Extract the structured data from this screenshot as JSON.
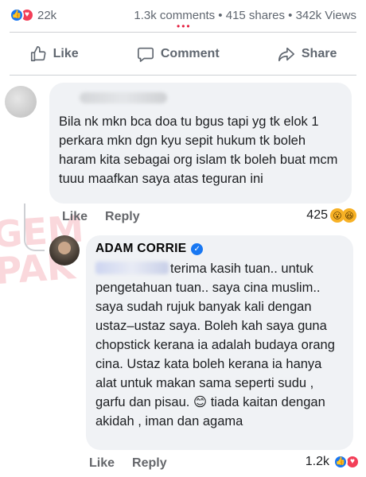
{
  "stats": {
    "reactions_count": "22k",
    "comments": "1.3k comments",
    "shares": "415 shares",
    "views": "342k Views",
    "separator": "•"
  },
  "actions": {
    "like_label": "Like",
    "comment_label": "Comment",
    "share_label": "Share"
  },
  "comment1": {
    "text": "Bila nk mkn bca doa tu bgus tapi yg tk elok 1 perkara mkn dgn kyu sepit hukum tk boleh haram kita sebagai org islam  tk boleh buat mcm tuuu maafkan saya atas teguran ini",
    "like_label": "Like",
    "reply_label": "Reply",
    "reaction_count": "425"
  },
  "comment2": {
    "author": "ADAM CORRIE",
    "text": "terima kasih tuan.. untuk pengetahuan tuan.. saya cina muslim..  saya sudah rujuk banyak kali dengan ustaz–ustaz saya. Boleh kah saya guna chopstick kerana ia adalah budaya orang cina. Ustaz kata boleh kerana ia hanya alat untuk makan sama seperti sudu , garfu dan pisau. 😊 tiada kaitan dengan akidah , iman dan agama",
    "like_label": "Like",
    "reply_label": "Reply",
    "reaction_count": "1.2k"
  },
  "colors": {
    "accent": "#1877f2",
    "love": "#f33e58",
    "bubble": "#f0f2f5",
    "muted": "#65676b"
  },
  "icons": [
    "like-icon",
    "love-icon",
    "haha-icon",
    "wow-icon",
    "thumbs-up-icon",
    "comment-icon",
    "share-icon",
    "verified-icon"
  ]
}
